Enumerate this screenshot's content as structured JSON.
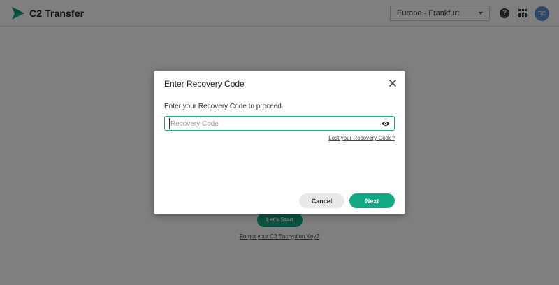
{
  "header": {
    "app_title": "C2 Transfer",
    "logo_icon": "send-arrow-icon",
    "region": "Europe - Frankfurt",
    "help_icon": "help-circle-icon",
    "apps_icon": "apps-grid-icon",
    "avatar_initials": "SC"
  },
  "background_page": {
    "start_button_label": "Let's Start",
    "forgot_key_link": "Forgot your C2 Encryption Key?"
  },
  "modal": {
    "title": "Enter Recovery Code",
    "close_icon": "close-icon",
    "prompt": "Enter your Recovery Code to proceed.",
    "input_placeholder": "Recovery Code",
    "input_value": "",
    "eye_icon": "eye-icon",
    "lost_code_link": "Lost your Recovery Code?",
    "cancel_label": "Cancel",
    "next_label": "Next"
  },
  "colors": {
    "accent": "#12a884",
    "overlay": "rgba(0,0,0,0.5)",
    "avatar": "#5b8fd6"
  }
}
